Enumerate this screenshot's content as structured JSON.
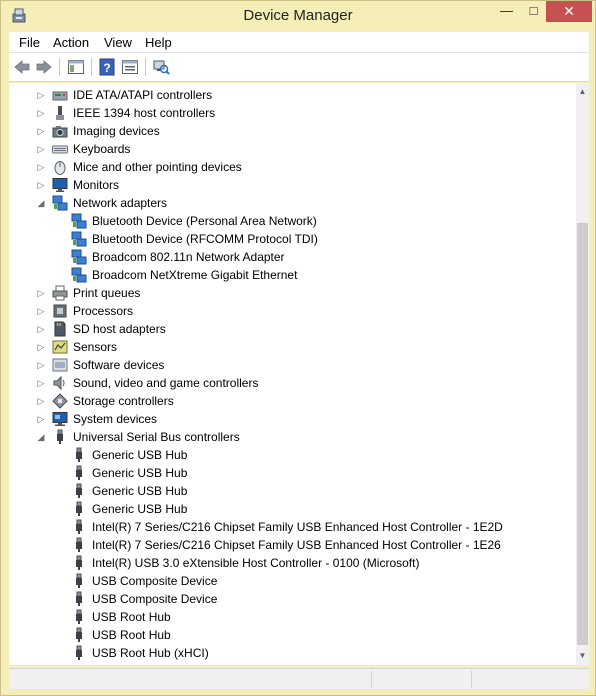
{
  "window": {
    "title": "Device Manager"
  },
  "caption_buttons": {
    "minimize": "—",
    "maximize": "□",
    "close": "✕"
  },
  "menu": [
    "File",
    "Action",
    "View",
    "Help"
  ],
  "toolbar": {
    "buttons": [
      "back-arrow-icon",
      "forward-arrow-icon",
      "show-hide-console-tree-icon",
      "help-icon",
      "properties-icon",
      "scan-hardware-icon"
    ]
  },
  "tree": {
    "rows": [
      {
        "label": "IDE ATA/ATAPI controllers",
        "level": 0,
        "state": "collapsed",
        "icon": "ide-controller-icon"
      },
      {
        "label": "IEEE 1394 host controllers",
        "level": 0,
        "state": "collapsed",
        "icon": "ieee1394-icon"
      },
      {
        "label": "Imaging devices",
        "level": 0,
        "state": "collapsed",
        "icon": "camera-icon"
      },
      {
        "label": "Keyboards",
        "level": 0,
        "state": "collapsed",
        "icon": "keyboard-icon"
      },
      {
        "label": "Mice and other pointing devices",
        "level": 0,
        "state": "collapsed",
        "icon": "mouse-icon"
      },
      {
        "label": "Monitors",
        "level": 0,
        "state": "collapsed",
        "icon": "monitor-icon"
      },
      {
        "label": "Network adapters",
        "level": 0,
        "state": "expanded",
        "icon": "network-adapter-icon"
      },
      {
        "label": "Bluetooth Device (Personal Area Network)",
        "level": 1,
        "state": "leaf",
        "icon": "network-adapter-icon"
      },
      {
        "label": "Bluetooth Device (RFCOMM Protocol TDI)",
        "level": 1,
        "state": "leaf",
        "icon": "network-adapter-icon"
      },
      {
        "label": "Broadcom 802.11n Network Adapter",
        "level": 1,
        "state": "leaf",
        "icon": "network-adapter-icon"
      },
      {
        "label": "Broadcom NetXtreme Gigabit Ethernet",
        "level": 1,
        "state": "leaf",
        "icon": "network-adapter-icon"
      },
      {
        "label": "Print queues",
        "level": 0,
        "state": "collapsed",
        "icon": "printer-icon"
      },
      {
        "label": "Processors",
        "level": 0,
        "state": "collapsed",
        "icon": "processor-icon"
      },
      {
        "label": "SD host adapters",
        "level": 0,
        "state": "collapsed",
        "icon": "sd-card-icon"
      },
      {
        "label": "Sensors",
        "level": 0,
        "state": "collapsed",
        "icon": "sensor-icon"
      },
      {
        "label": "Software devices",
        "level": 0,
        "state": "collapsed",
        "icon": "software-device-icon"
      },
      {
        "label": "Sound, video and game controllers",
        "level": 0,
        "state": "collapsed",
        "icon": "speaker-icon"
      },
      {
        "label": "Storage controllers",
        "level": 0,
        "state": "collapsed",
        "icon": "storage-controller-icon"
      },
      {
        "label": "System devices",
        "level": 0,
        "state": "collapsed",
        "icon": "system-devices-icon"
      },
      {
        "label": "Universal Serial Bus controllers",
        "level": 0,
        "state": "expanded",
        "icon": "usb-icon"
      },
      {
        "label": "Generic USB Hub",
        "level": 1,
        "state": "leaf",
        "icon": "usb-icon"
      },
      {
        "label": "Generic USB Hub",
        "level": 1,
        "state": "leaf",
        "icon": "usb-icon"
      },
      {
        "label": "Generic USB Hub",
        "level": 1,
        "state": "leaf",
        "icon": "usb-icon"
      },
      {
        "label": "Generic USB Hub",
        "level": 1,
        "state": "leaf",
        "icon": "usb-icon"
      },
      {
        "label": "Intel(R) 7 Series/C216 Chipset Family USB Enhanced Host Controller - 1E2D",
        "level": 1,
        "state": "leaf",
        "icon": "usb-icon"
      },
      {
        "label": "Intel(R) 7 Series/C216 Chipset Family USB Enhanced Host Controller - 1E26",
        "level": 1,
        "state": "leaf",
        "icon": "usb-icon"
      },
      {
        "label": "Intel(R) USB 3.0 eXtensible Host Controller - 0100 (Microsoft)",
        "level": 1,
        "state": "leaf",
        "icon": "usb-icon"
      },
      {
        "label": "USB Composite Device",
        "level": 1,
        "state": "leaf",
        "icon": "usb-icon"
      },
      {
        "label": "USB Composite Device",
        "level": 1,
        "state": "leaf",
        "icon": "usb-icon"
      },
      {
        "label": "USB Root Hub",
        "level": 1,
        "state": "leaf",
        "icon": "usb-icon"
      },
      {
        "label": "USB Root Hub",
        "level": 1,
        "state": "leaf",
        "icon": "usb-icon"
      },
      {
        "label": "USB Root Hub (xHCI)",
        "level": 1,
        "state": "leaf",
        "icon": "usb-icon"
      }
    ]
  },
  "scrollbar": {
    "position": 0.74,
    "up": "▲",
    "down": "▼"
  },
  "colors": {
    "frame": "#f5eeb8",
    "close": "#c75050",
    "window_bg": "#ffffff"
  }
}
